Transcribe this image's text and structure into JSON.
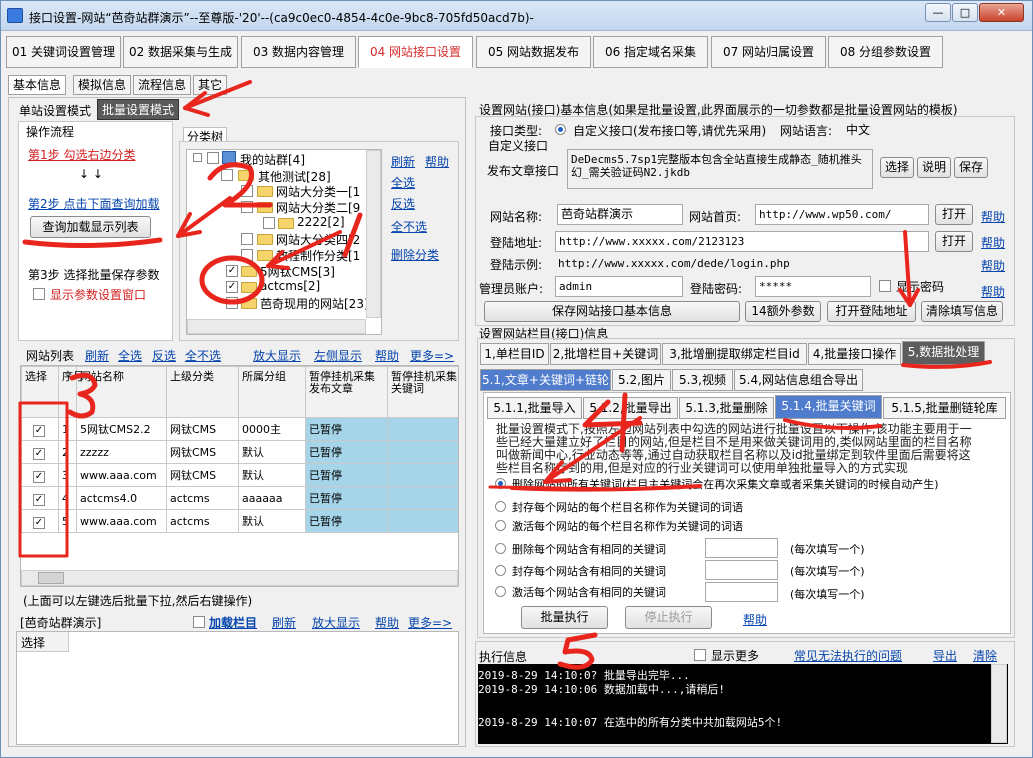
{
  "window": {
    "title": "接口设置-网站“芭奇站群演示”--至尊版-'20'--(ca9c0ec0-4854-4c0e-9bc8-705fd50acd7b)-"
  },
  "main_tabs": [
    "01 关键词设置管理",
    "02 数据采集与生成",
    "03 数据内容管理",
    "04 网站接口设置",
    "05 网站数据发布",
    "06 指定域名采集",
    "07 网站归属设置",
    "08 分组参数设置"
  ],
  "sub_tabs": [
    "基本信息",
    "模拟信息",
    "流程信息",
    "其它"
  ],
  "mode_tabs": [
    "单站设置模式",
    "批量设置模式"
  ],
  "flow": {
    "title": "操作流程",
    "step1": "第1步 勾选右边分类",
    "arrows": "↓ ↓",
    "step2": "第2步 点击下面查询加载",
    "load_button": "查询加载显示列表",
    "step3": "第3步 选择批量保存参数",
    "show_param": "显示参数设置窗口"
  },
  "tree": {
    "title": "分类树",
    "root": "我的站群[4]",
    "n1": "其他测试[28]",
    "n2": "网站大分类一[1",
    "n3": "网站大分类二[9",
    "n4": "2222[2]",
    "n5": "网站大分类四[2",
    "n6": "教程制作分类[1",
    "n7": "5网钛CMS[3]",
    "n8": "actcms[2]",
    "n9": "芭奇现用的网站[23]",
    "links": [
      "刷新",
      "帮助",
      "全选",
      "反选",
      "全不选",
      "删除分类"
    ]
  },
  "site_list": {
    "title": "网站列表",
    "links": [
      "刷新",
      "全选",
      "反选",
      "全不选",
      "放大显示",
      "左侧显示",
      "帮助",
      "更多=>"
    ],
    "headers": [
      "选择",
      "序号",
      "网站名称",
      "上级分类",
      "所属分组",
      "暂停挂机采集发布文章",
      "暂停挂机采集关键词"
    ],
    "rows": [
      {
        "idx": "1",
        "name": "5网钛CMS2.2",
        "parent": "网钛CMS",
        "group": "0000主",
        "pause": "已暂停"
      },
      {
        "idx": "2",
        "name": "zzzzz",
        "parent": "网钛CMS",
        "group": "默认",
        "pause": "已暂停"
      },
      {
        "idx": "3",
        "name": "www.aaa.com",
        "parent": "网钛CMS",
        "group": "默认",
        "pause": "已暂停"
      },
      {
        "idx": "4",
        "name": "actcms4.0",
        "parent": "actcms",
        "group": "aaaaaa",
        "pause": "已暂停"
      },
      {
        "idx": "5",
        "name": "www.aaa.com",
        "parent": "actcms",
        "group": "默认",
        "pause": "已暂停"
      }
    ],
    "hint": "(上面可以左键选后批量下拉,然后右键操作)"
  },
  "bottom_left": {
    "site_name": "[芭奇站群演示]",
    "load_columns": "加载栏目",
    "links": [
      "刷新",
      "放大显示",
      "帮助",
      "更多=>"
    ],
    "col_header": "选择"
  },
  "settings": {
    "title": "设置网站(接口)基本信息(如果是批量设置,此界面展示的一切参数都是批量设置网站的模板)",
    "iface_type_label": "接口类型:",
    "iface_type_value": "自定义接口(发布接口等,请优先采用)",
    "lang_label": "网站语言:",
    "lang_value": "中文",
    "custom_iface": "自定义接口",
    "publish_label": "发布文章接口",
    "publish_value": "DeDecms5.7sp1完整版本包含全站直接生成静态_随机推头幻_需关验证码N2.jkdb",
    "btn_select": "选择",
    "btn_explain": "说明",
    "btn_save": "保存",
    "site_name_label": "网站名称:",
    "site_name_value": "芭奇站群演示",
    "home_label": "网站首页:",
    "home_value": "http://www.wp50.com/",
    "login_url_label": "登陆地址:",
    "login_url_value": "http://www.xxxxx.com/2123123",
    "login_example_label": "登陆示例:",
    "login_example_value": "http://www.xxxxx.com/dede/login.php",
    "admin_label": "管理员账户:",
    "admin_value": "admin",
    "pwd_label": "登陆密码:",
    "pwd_value": "*****",
    "show_pwd": "显示密码",
    "btn_open": "打开",
    "help": "帮助",
    "btn_save_basic": "保存网站接口基本信息",
    "btn_extra": "14额外参数",
    "btn_open_login": "打开登陆地址",
    "btn_clear": "清除填写信息"
  },
  "column_section": {
    "title": "设置网站栏目(接口)信息",
    "tabs": [
      "1,单栏目ID",
      "2,批增栏目+关键词",
      "3,批增删提取绑定栏目id",
      "4,批量接口操作",
      "5,数据批处理"
    ],
    "tabs2": [
      "5.1,文章+关键词+链轮",
      "5.2,图片",
      "5.3,视频",
      "5.4,网站信息组合导出"
    ],
    "tabs3": [
      "5.1.1,批量导入",
      "5.1.2,批量导出",
      "5.1.3,批量删除",
      "5.1.4,批量关键词",
      "5.1.5,批量删链轮库"
    ],
    "note": "批量设置模式下,按照左边网站列表中勾选的网站进行批量设置以下操作,该功能主要用于一些已经大量建立好了栏目的网站,但是栏目不是用来做关键词用的,类似网站里面的栏目名称叫做新闻中心,行业动态等等,通过自动获取栏目名称以及id批量绑定到软件里面后需要将这些栏目名称存到的用,但是对应的行业关键词可以使用单独批量导入的方式实现",
    "options": [
      "删除网站的所有关键词(栏目主关键词会在再次采集文章或者采集关键词的时候自动产生)",
      "封存每个网站的每个栏目名称作为关键词的词语",
      "激活每个网站的每个栏目名称作为关键词的词语",
      "删除每个网站含有相同的关键词",
      "封存每个网站含有相同的关键词",
      "激活每个网站含有相同的关键词"
    ],
    "fill_hint": "(每次填写一个)",
    "btn_run": "批量执行",
    "btn_stop": "停止执行",
    "help": "帮助"
  },
  "exec": {
    "title": "执行信息",
    "show_more": "显示更多",
    "common_issue": "常见无法执行的问题",
    "export": "导出",
    "clear": "清除",
    "lines": [
      "2019-8-29 14:10:0?  批量导出完毕...",
      "2019-8-29 14:10:06  数据加载中...,请稍后!",
      "",
      "2019-8-29 14:10:07  在选中的所有分类中共加载网站5个!"
    ]
  },
  "annotations": [
    "1",
    "2",
    "3",
    "4",
    "5"
  ]
}
